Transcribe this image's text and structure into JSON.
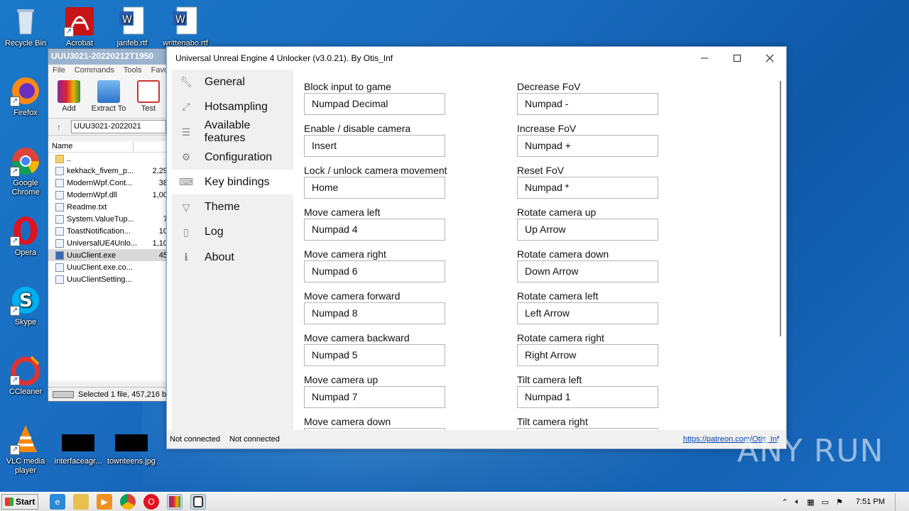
{
  "desktop": {
    "icons": [
      {
        "label": "Recycle Bin"
      },
      {
        "label": "Acrobat"
      },
      {
        "label": "janfeb.rtf"
      },
      {
        "label": "writtenabo.rtf"
      },
      {
        "label": "Firefox"
      },
      {
        "label": "Google Chrome"
      },
      {
        "label": "Opera"
      },
      {
        "label": "Skype"
      },
      {
        "label": "CCleaner"
      },
      {
        "label": "VLC media player"
      },
      {
        "label": "interfaceagr..."
      },
      {
        "label": "townteens.jpg"
      }
    ]
  },
  "winrar": {
    "title": "UUU3021-20220212T1950",
    "menu": [
      "File",
      "Commands",
      "Tools",
      "Favori"
    ],
    "tools": [
      "Add",
      "Extract To",
      "Test"
    ],
    "path": "UUU3021-2022021",
    "columns": [
      "Name",
      ""
    ],
    "files": [
      {
        "name": "..",
        "size": ""
      },
      {
        "name": "kekhack_fivem_p...",
        "size": "2,29"
      },
      {
        "name": "ModernWpf.Cont...",
        "size": "38"
      },
      {
        "name": "ModernWpf.dll",
        "size": "1,00"
      },
      {
        "name": "Readme.txt",
        "size": ""
      },
      {
        "name": "System.ValueTup...",
        "size": "7"
      },
      {
        "name": "ToastNotification...",
        "size": "10"
      },
      {
        "name": "UniversalUE4Unlo...",
        "size": "1,10"
      },
      {
        "name": "UuuClient.exe",
        "size": "45"
      },
      {
        "name": "UuuClient.exe.co...",
        "size": ""
      },
      {
        "name": "UuuClientSetting...",
        "size": ""
      }
    ],
    "status": "Selected 1 file, 457,216 b"
  },
  "app": {
    "title": "Universal Unreal Engine 4 Unlocker (v3.0.21). By Otis_Inf",
    "nav": [
      {
        "label": "General",
        "icon": "wrench-icon"
      },
      {
        "label": "Hotsampling",
        "icon": "resize-icon"
      },
      {
        "label": "Available features",
        "icon": "list-icon"
      },
      {
        "label": "Configuration",
        "icon": "gear-icon"
      },
      {
        "label": "Key bindings",
        "icon": "keyboard-icon",
        "active": true
      },
      {
        "label": "Theme",
        "icon": "brush-icon"
      },
      {
        "label": "Log",
        "icon": "document-icon"
      },
      {
        "label": "About",
        "icon": "info-icon"
      }
    ],
    "bindings_left": [
      {
        "label": "Block input to game",
        "value": "Numpad Decimal"
      },
      {
        "label": "Enable / disable camera",
        "value": "Insert"
      },
      {
        "label": "Lock / unlock camera movement",
        "value": "Home"
      },
      {
        "label": "Move camera left",
        "value": "Numpad 4"
      },
      {
        "label": "Move camera right",
        "value": "Numpad 6"
      },
      {
        "label": "Move camera forward",
        "value": "Numpad 8"
      },
      {
        "label": "Move camera backward",
        "value": "Numpad 5"
      },
      {
        "label": "Move camera up",
        "value": "Numpad 7"
      },
      {
        "label": "Move camera down",
        "value": ""
      }
    ],
    "bindings_right": [
      {
        "label": "Decrease FoV",
        "value": "Numpad -"
      },
      {
        "label": "Increase FoV",
        "value": "Numpad +"
      },
      {
        "label": "Reset FoV",
        "value": "Numpad *"
      },
      {
        "label": "Rotate camera up",
        "value": "Up Arrow"
      },
      {
        "label": "Rotate camera down",
        "value": "Down Arrow"
      },
      {
        "label": "Rotate camera left",
        "value": "Left Arrow"
      },
      {
        "label": "Rotate camera right",
        "value": "Right Arrow"
      },
      {
        "label": "Tilt camera left",
        "value": "Numpad 1"
      },
      {
        "label": "Tilt camera right",
        "value": ""
      }
    ],
    "status_1": "Not connected",
    "status_2": "Not connected",
    "link": "https://patreon.com/Otis_Inf"
  },
  "taskbar": {
    "start_label": "Start",
    "clock": "7:51 PM"
  },
  "watermark": "ANY RUN"
}
